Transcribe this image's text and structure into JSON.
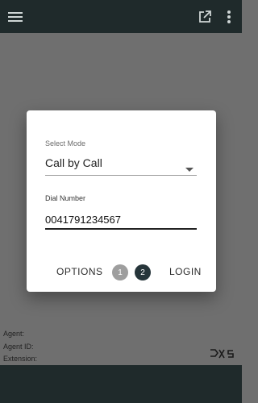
{
  "topbar": {
    "menu_icon": "hamburger-menu-icon",
    "external_icon": "open-external-icon",
    "more_icon": "more-vertical-icon"
  },
  "dialog": {
    "mode_label": "Select Mode",
    "mode_value": "Call by Call",
    "dial_label": "Dial Number",
    "dial_value": "0041791234567",
    "options_label": "OPTIONS",
    "steps": [
      "1",
      "2"
    ],
    "active_step": 2,
    "login_label": "LOGIN"
  },
  "info": {
    "agent_label": "Agent:",
    "agent_id_label": "Agent ID:",
    "extension_label": "Extension:"
  },
  "colors": {
    "bar": "#1f2a2b",
    "overlay": "#6f6f6f",
    "active_step": "#26353a",
    "inactive_step": "#9e9e9e"
  }
}
